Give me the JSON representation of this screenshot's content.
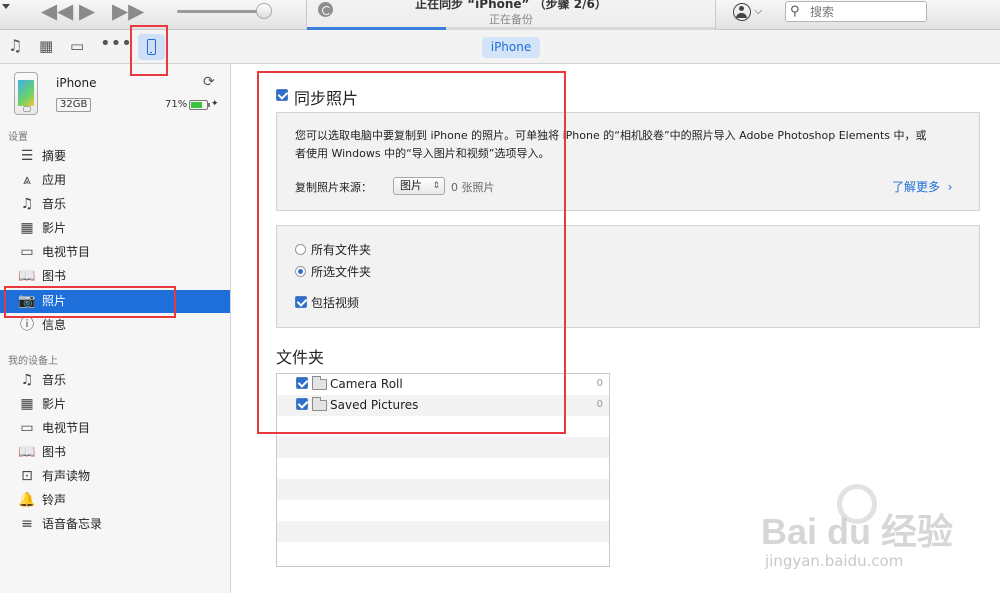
{
  "titlebar": {
    "sync_title": "正在同步 “iPhone” （步骤 2/6）",
    "sync_subtitle": "正在备份",
    "sync_progress": 0.34,
    "search_placeholder": "搜索"
  },
  "toolbar": {
    "device_tab_label": "iPhone"
  },
  "device": {
    "name": "iPhone",
    "capacity": "32GB",
    "battery_percent": "71%",
    "battery_level": 0.71
  },
  "sidebar": {
    "settings_header": "设置",
    "settings_items": [
      {
        "label": "摘要",
        "icon": "summary-icon"
      },
      {
        "label": "应用",
        "icon": "apps-icon"
      },
      {
        "label": "音乐",
        "icon": "music-icon"
      },
      {
        "label": "影片",
        "icon": "film-icon"
      },
      {
        "label": "电视节目",
        "icon": "tv-icon"
      },
      {
        "label": "图书",
        "icon": "book-icon"
      },
      {
        "label": "照片",
        "icon": "camera-icon"
      },
      {
        "label": "信息",
        "icon": "info-icon"
      }
    ],
    "on_device_header": "我的设备上",
    "device_items": [
      {
        "label": "音乐",
        "icon": "music-icon"
      },
      {
        "label": "影片",
        "icon": "film-icon"
      },
      {
        "label": "电视节目",
        "icon": "tv-icon"
      },
      {
        "label": "图书",
        "icon": "book-icon"
      },
      {
        "label": "有声读物",
        "icon": "audiobook-icon"
      },
      {
        "label": "铃声",
        "icon": "bell-icon"
      },
      {
        "label": "语音备忘录",
        "icon": "voice-memo-icon"
      }
    ]
  },
  "photos": {
    "sync_label": "同步照片",
    "sync_checked": true,
    "description": "您可以选取电脑中要复制到 iPhone 的照片。可单独将 iPhone 的“相机胶卷”中的照片导入 Adobe Photoshop Elements 中，或者使用 Windows 中的“导入图片和视频”选项导入。",
    "source_label": "复制照片来源：",
    "source_value": "图片",
    "source_count": "0 张照片",
    "learn_more": "了解更多",
    "options": {
      "all_folders": "所有文件夹",
      "selected_folders": "所选文件夹",
      "selected": "selected_folders",
      "include_videos": "包括视频",
      "include_videos_checked": true
    },
    "folders_title": "文件夹",
    "folders": [
      {
        "name": "Camera Roll",
        "count": "0",
        "checked": true
      },
      {
        "name": "Saved Pictures",
        "count": "0",
        "checked": true
      }
    ]
  },
  "watermark": {
    "brand": "Bai  du 经验",
    "url": "jingyan.baidu.com"
  },
  "colors": {
    "accent": "#1e6fd9",
    "highlight_box": "#e8393f",
    "sidebar_bg": "#f6f6f6",
    "panel_bg": "#f2f2f2"
  }
}
